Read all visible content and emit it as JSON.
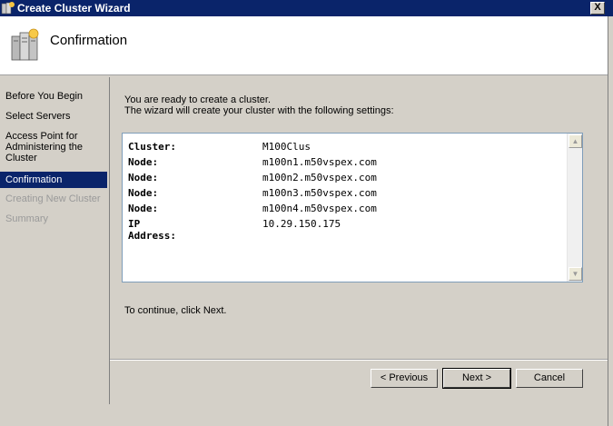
{
  "window": {
    "title": "Create Cluster Wizard",
    "close_label": "X"
  },
  "header": {
    "title": "Confirmation"
  },
  "nav": {
    "items": [
      {
        "label": "Before You Begin"
      },
      {
        "label": "Select Servers"
      },
      {
        "label": "Access Point for\nAdministering the\nCluster"
      },
      {
        "label": "Confirmation"
      },
      {
        "label": "Creating New Cluster"
      },
      {
        "label": "Summary"
      }
    ]
  },
  "main": {
    "intro_line1": "You are ready to create a cluster.",
    "intro_line2": "The wizard will create your cluster with the following settings:",
    "settings": [
      {
        "key": "Cluster:",
        "value": "M100Clus"
      },
      {
        "key": "Node:",
        "value": "m100n1.m50vspex.com"
      },
      {
        "key": "Node:",
        "value": "m100n2.m50vspex.com"
      },
      {
        "key": "Node:",
        "value": "m100n3.m50vspex.com"
      },
      {
        "key": "Node:",
        "value": "m100n4.m50vspex.com"
      },
      {
        "key": "IP Address:",
        "value": "10.29.150.175"
      }
    ],
    "continue_text": "To continue, click Next."
  },
  "buttons": {
    "previous": "< Previous",
    "next": "Next >",
    "cancel": "Cancel"
  },
  "colors": {
    "titlebar": "#0a246a",
    "selected_nav": "#0a246a",
    "dialog_bg": "#d4d0c8"
  }
}
